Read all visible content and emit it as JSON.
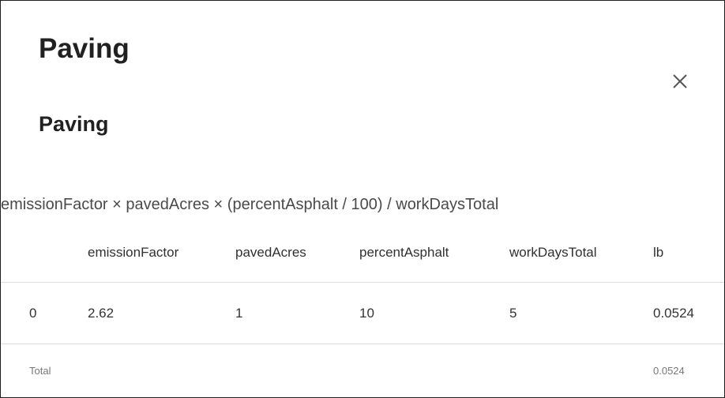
{
  "dialog": {
    "title": "Paving",
    "close_icon": "close-icon"
  },
  "section": {
    "title": "Paving",
    "formula": "emissionFactor × pavedAcres × (percentAsphalt / 100) / workDaysTotal"
  },
  "table": {
    "columns": [
      "",
      "emissionFactor",
      "pavedAcres",
      "percentAsphalt",
      "workDaysTotal",
      "lb"
    ],
    "rows": [
      [
        "0",
        "2.62",
        "1",
        "10",
        "5",
        "0.0524"
      ]
    ],
    "total": {
      "label": "Total",
      "value": "0.0524"
    }
  }
}
